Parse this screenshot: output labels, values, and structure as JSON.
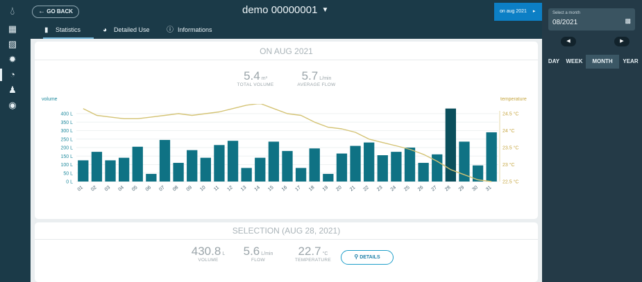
{
  "rail": {
    "icons": [
      "dashboard-icon",
      "buildings-icon",
      "water-meter-icon",
      "gauge-icon",
      "users-icon",
      "account-icon"
    ]
  },
  "header": {
    "go_back": "GO BACK",
    "device": "demo 00000001",
    "period_button": "on aug 2021"
  },
  "tabs": [
    {
      "label": "Statistics",
      "icon": "bar-chart-icon",
      "active": true
    },
    {
      "label": "Detailed Use",
      "icon": "pie-chart-icon",
      "active": false
    },
    {
      "label": "Informations",
      "icon": "info-icon",
      "active": false
    }
  ],
  "summary": {
    "title": "ON AUG 2021",
    "total_volume": {
      "value": "5.4",
      "unit": "m³",
      "label": "TOTAL VOLUME"
    },
    "average_flow": {
      "value": "5.7",
      "unit": "L/min",
      "label": "AVERAGE FLOW"
    },
    "left_axis_label": "volume",
    "right_axis_label": "temperature"
  },
  "chart_data": {
    "type": "bar",
    "categories": [
      "01",
      "02",
      "03",
      "04",
      "05",
      "06",
      "07",
      "08",
      "09",
      "10",
      "11",
      "12",
      "13",
      "14",
      "15",
      "16",
      "17",
      "18",
      "19",
      "20",
      "21",
      "22",
      "23",
      "24",
      "25",
      "26",
      "27",
      "28",
      "29",
      "30",
      "31"
    ],
    "series": [
      {
        "name": "volume",
        "type": "bar",
        "axis": "left",
        "values": [
          125,
          175,
          125,
          140,
          205,
          45,
          245,
          110,
          185,
          140,
          215,
          240,
          80,
          140,
          235,
          180,
          80,
          195,
          45,
          165,
          210,
          230,
          155,
          175,
          200,
          110,
          160,
          430,
          235,
          95,
          290
        ]
      },
      {
        "name": "temperature",
        "type": "line",
        "axis": "right",
        "values": [
          24.65,
          24.45,
          24.4,
          24.35,
          24.35,
          24.4,
          24.45,
          24.5,
          24.45,
          24.5,
          24.55,
          24.65,
          24.75,
          24.8,
          24.65,
          24.5,
          24.45,
          24.25,
          24.1,
          24.05,
          23.95,
          23.75,
          23.65,
          23.55,
          23.45,
          23.3,
          23.1,
          22.85,
          22.7,
          22.55,
          22.5
        ]
      }
    ],
    "left_ticks": [
      "400 L",
      "350 L",
      "300 L",
      "250 L",
      "200 L",
      "150 L",
      "100 L",
      "50 L",
      "0 L"
    ],
    "right_ticks": [
      "24.5 °C",
      "24 °C",
      "23.5 °C",
      "23 °C",
      "22.5 °C"
    ],
    "ylim": [
      0,
      420
    ],
    "y2lim": [
      22.5,
      24.85
    ],
    "bar_colors": {
      "normal": "#0f7284",
      "selected": "#0b4f5c"
    },
    "line_color": "#d4c374",
    "selected_index": 27
  },
  "selection": {
    "title": "SELECTION (AUG 28, 2021)",
    "volume": {
      "value": "430.8",
      "unit": "L",
      "label": "VOLUME"
    },
    "flow": {
      "value": "5.6",
      "unit": "L/min",
      "label": "FLOW"
    },
    "temperature": {
      "value": "22.7",
      "unit": "°C",
      "label": "TEMPERATURE"
    },
    "details_button": "DETAILS"
  },
  "side": {
    "month_label": "Select a month",
    "month_value": "08/2021",
    "granularity": [
      {
        "label": "DAY",
        "active": false
      },
      {
        "label": "WEEK",
        "active": false
      },
      {
        "label": "MONTH",
        "active": true
      },
      {
        "label": "YEAR",
        "active": false
      }
    ]
  }
}
